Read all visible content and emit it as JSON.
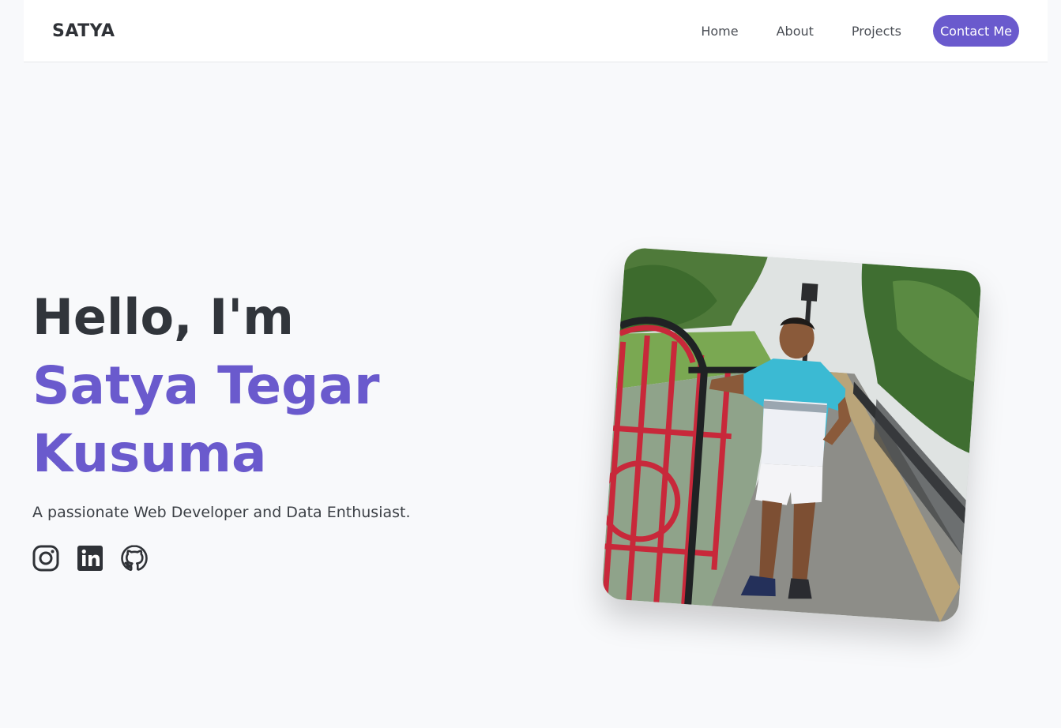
{
  "nav": {
    "brand": "SATYA",
    "links": [
      {
        "label": "Home"
      },
      {
        "label": "About"
      },
      {
        "label": "Projects"
      }
    ],
    "contact_label": "Contact Me"
  },
  "hero": {
    "greeting": "Hello, I'm",
    "name_line1": "Satya Tegar",
    "name_line2": "Kusuma",
    "tagline": "A passionate Web Developer and Data Enthusiast.",
    "socials": [
      {
        "icon": "instagram-icon"
      },
      {
        "icon": "linkedin-icon"
      },
      {
        "icon": "github-icon"
      }
    ],
    "photo": {
      "icon": "profile-photo"
    }
  },
  "colors": {
    "accent": "#6a5acd",
    "heading": "#31353b",
    "background": "#f8f9fb"
  }
}
